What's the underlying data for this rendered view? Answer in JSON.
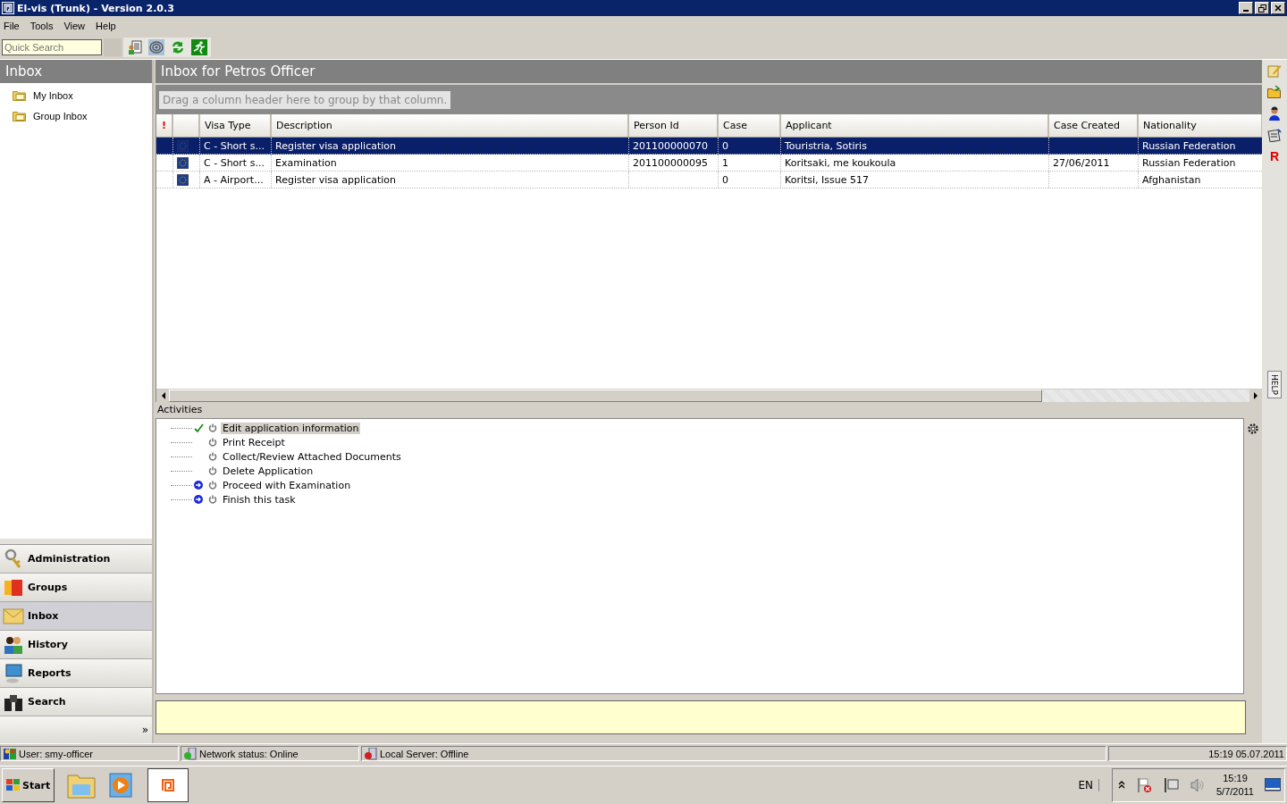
{
  "window": {
    "title": "El-vis (Trunk) - Version 2.0.3"
  },
  "menu": [
    "File",
    "Tools",
    "View",
    "Help"
  ],
  "quick_search": {
    "placeholder": "Quick Search"
  },
  "sidebar": {
    "title": "Inbox",
    "items": [
      {
        "label": "My Inbox"
      },
      {
        "label": "Group Inbox"
      }
    ],
    "nav": [
      {
        "label": "Administration",
        "selected": false
      },
      {
        "label": "Groups",
        "selected": false
      },
      {
        "label": "Inbox",
        "selected": true
      },
      {
        "label": "History",
        "selected": false
      },
      {
        "label": "Reports",
        "selected": false
      },
      {
        "label": "Search",
        "selected": false
      }
    ],
    "more": "»"
  },
  "content": {
    "title": "Inbox for Petros Officer",
    "group_hint": "Drag a column header here to group by that column.",
    "table": {
      "priority_header": "!",
      "columns": [
        "Visa Type",
        "Description",
        "Person Id",
        "Case",
        "Applicant",
        "Case Created",
        "Nationality"
      ],
      "rows": [
        {
          "selected": true,
          "cells": [
            "C - Short s...",
            "Register visa application",
            "201100000070",
            "0",
            "Touristria, Sotiris",
            null,
            "Russian Federation"
          ]
        },
        {
          "selected": false,
          "cells": [
            "C - Short s...",
            "Examination",
            "201100000095",
            "1",
            "Koritsaki, me koukoula",
            "27/06/2011",
            "Russian Federation"
          ]
        },
        {
          "selected": false,
          "cells": [
            "A - Airport...",
            "Register visa application",
            null,
            "0",
            "Koritsi, Issue 517",
            null,
            "Afghanistan"
          ]
        }
      ]
    },
    "activities": {
      "title": "Activities",
      "items": [
        {
          "label": "Edit application information",
          "kind": "done",
          "selected": true
        },
        {
          "label": "Print Receipt",
          "kind": "plain",
          "selected": false
        },
        {
          "label": "Collect/Review Attached Documents",
          "kind": "plain",
          "selected": false
        },
        {
          "label": "Delete Application",
          "kind": "plain",
          "selected": false
        },
        {
          "label": "Proceed with Examination",
          "kind": "next",
          "selected": false
        },
        {
          "label": "Finish this task",
          "kind": "next",
          "selected": false
        }
      ]
    }
  },
  "right_tools": {
    "letter": "R",
    "help_tab": "HELP"
  },
  "status_bar": {
    "user": "User: smy-officer",
    "network": "Network status: Online",
    "local_server": "Local Server:  Offline",
    "datetime": "15:19 05.07.2011"
  },
  "taskbar": {
    "start": "Start",
    "language": "EN",
    "time": "15:19",
    "date": "5/7/2011"
  }
}
